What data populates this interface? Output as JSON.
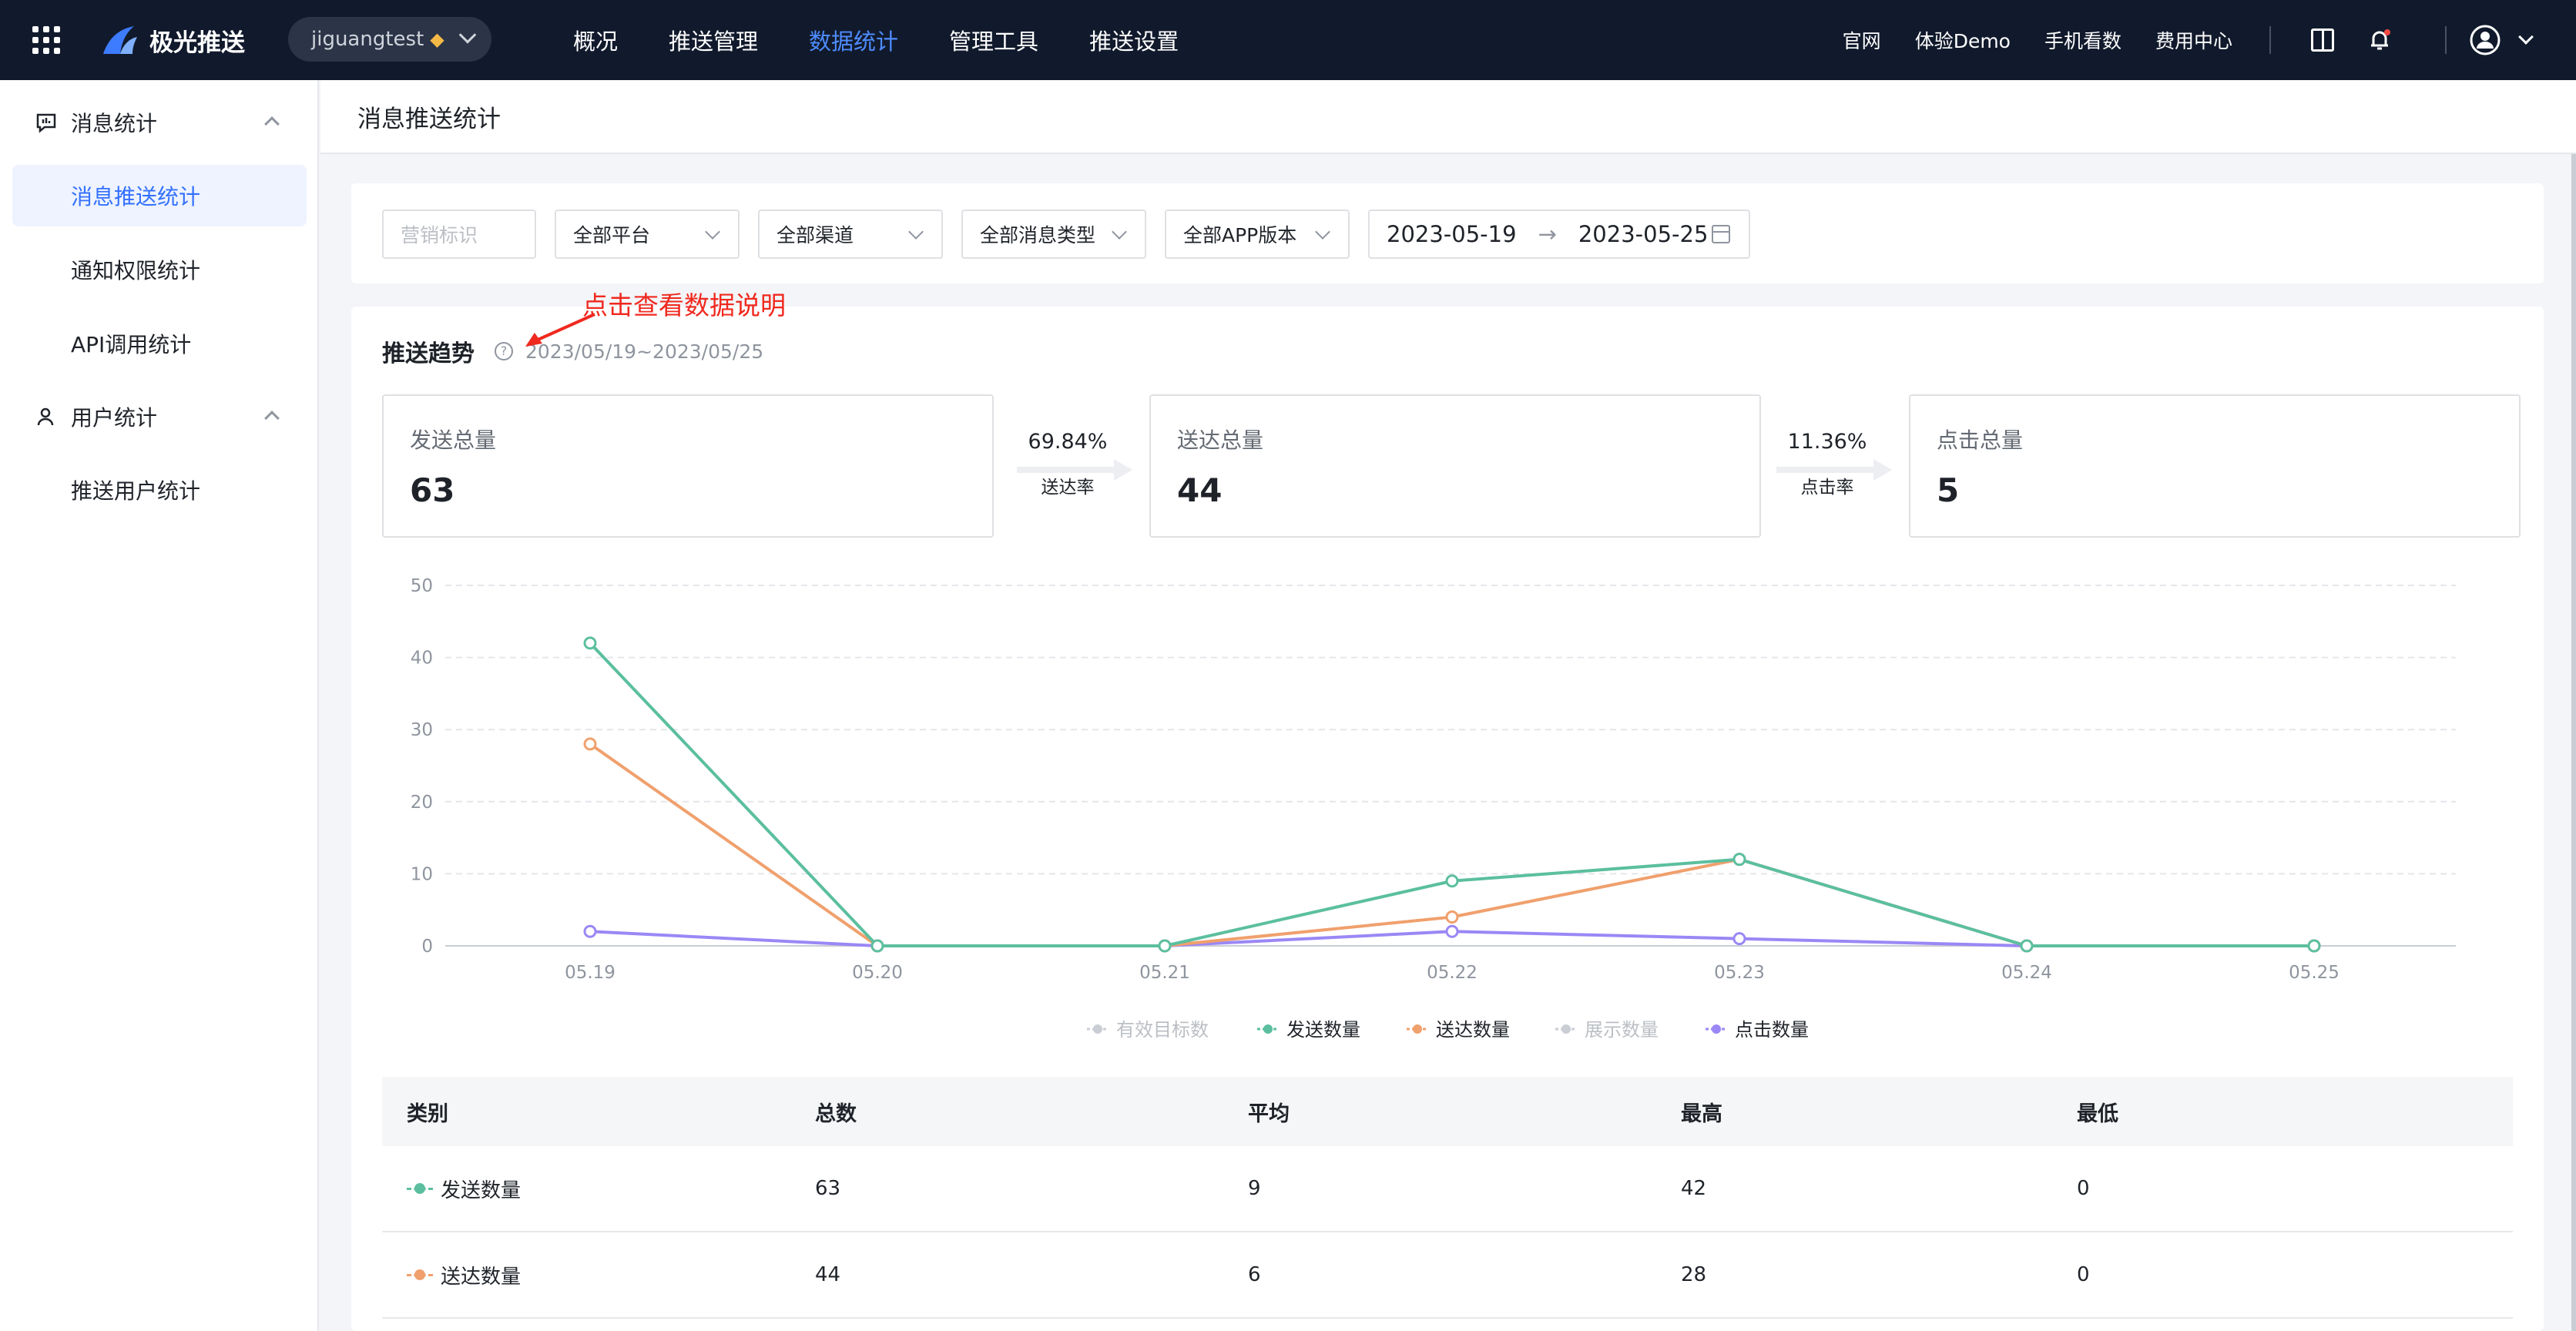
{
  "topbar": {
    "brand": "极光推送",
    "app_name": "jiguangtest",
    "nav": [
      "概况",
      "推送管理",
      "数据统计",
      "管理工具",
      "推送设置"
    ],
    "nav_active": 2,
    "links": [
      "官网",
      "体验Demo",
      "手机看数",
      "费用中心"
    ]
  },
  "sidebar": {
    "group1": "消息统计",
    "group1_items": [
      "消息推送统计",
      "通知权限统计",
      "API调用统计"
    ],
    "group2": "用户统计",
    "group2_items": [
      "推送用户统计"
    ],
    "active_item": "消息推送统计"
  },
  "page": {
    "title": "消息推送统计"
  },
  "filters": {
    "marketing_placeholder": "营销标识",
    "platform": "全部平台",
    "channel": "全部渠道",
    "msg_type": "全部消息类型",
    "app_version": "全部APP版本",
    "date_start": "2023-05-19",
    "date_end": "2023-05-25"
  },
  "trend": {
    "title": "推送趋势",
    "range": "2023/05/19~2023/05/25",
    "annotation": "点击查看数据说明",
    "sent_label": "发送总量",
    "sent_value": "63",
    "delivery_rate": "69.84%",
    "delivery_rate_label": "送达率",
    "delivered_label": "送达总量",
    "delivered_value": "44",
    "click_rate": "11.36%",
    "click_rate_label": "点击率",
    "click_label": "点击总量",
    "click_value": "5"
  },
  "chart_data": {
    "type": "line",
    "categories": [
      "05.19",
      "05.20",
      "05.21",
      "05.22",
      "05.23",
      "05.24",
      "05.25"
    ],
    "ylim": [
      0,
      50
    ],
    "yticks": [
      0,
      10,
      20,
      30,
      40,
      50
    ],
    "grid": true,
    "legend_position": "bottom",
    "series": [
      {
        "name": "有效目标数",
        "values": [],
        "color": "#c9cdd4",
        "visible": false
      },
      {
        "name": "发送数量",
        "values": [
          42,
          0,
          0,
          9,
          12,
          0,
          0
        ],
        "color": "#5bbf9f",
        "visible": true
      },
      {
        "name": "送达数量",
        "values": [
          28,
          0,
          0,
          4,
          12,
          0,
          0
        ],
        "color": "#f0a06d",
        "visible": true
      },
      {
        "name": "展示数量",
        "values": [],
        "color": "#c9cdd4",
        "visible": false
      },
      {
        "name": "点击数量",
        "values": [
          2,
          0,
          0,
          2,
          1,
          0,
          0
        ],
        "color": "#9b87f5",
        "visible": true
      }
    ]
  },
  "table": {
    "headers": [
      "类别",
      "总数",
      "平均",
      "最高",
      "最低"
    ],
    "rows": [
      {
        "name": "发送数量",
        "total": "63",
        "avg": "9",
        "max": "42",
        "min": "0",
        "color": "#5bbf9f"
      },
      {
        "name": "送达数量",
        "total": "44",
        "avg": "6",
        "max": "28",
        "min": "0",
        "color": "#f0a06d"
      }
    ]
  }
}
